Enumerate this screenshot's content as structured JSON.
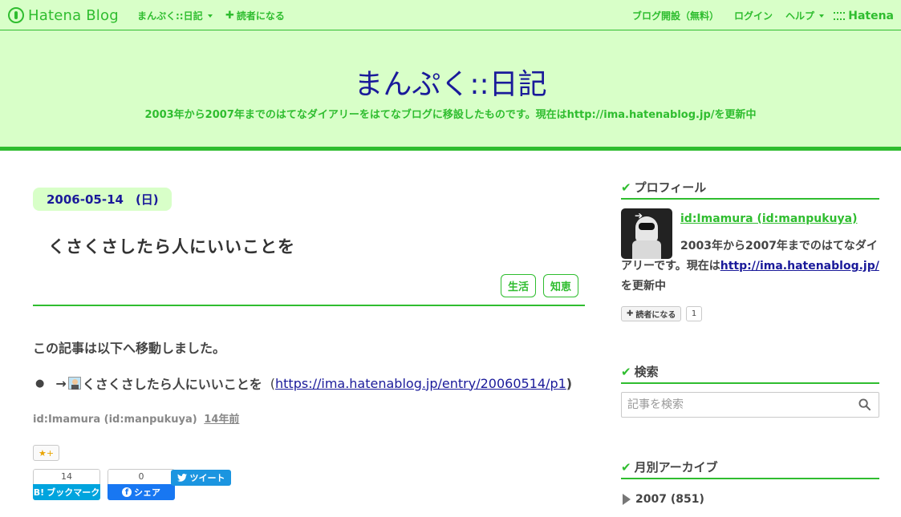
{
  "topbar": {
    "logo_text": "Hatena Blog",
    "blog_menu": "まんぷく::日記",
    "subscribe": "読者になる",
    "open_blog": "ブログ開設（無料）",
    "login": "ログイン",
    "help": "ヘルプ",
    "hatena": "Hatena"
  },
  "header": {
    "title": "まんぷく::日記",
    "description": "2003年から2007年までのはてなダイアリーをはてなブログに移設したものです。現在はhttp://ima.hatenablog.jp/を更新中"
  },
  "entry": {
    "date": "2006-05-14　(日)",
    "title": "くさくさしたら人にいいことを",
    "tags": [
      "生活",
      "知恵"
    ],
    "body": "この記事は以下へ移動しました。",
    "list_bullet": "●",
    "list_arrow": "→",
    "list_text": "くさくさしたら人にいいことを",
    "list_open_paren": "(",
    "list_link": "https://ima.hatenablog.jp/entry/20060514/p1",
    "list_close_paren": ")",
    "author": "id:Imamura (id:manpukuya)",
    "ago": "14年前",
    "star_plus": "+",
    "hatebu_count": "14",
    "hatebu_label": "ブックマーク",
    "fb_count": "0",
    "fb_label": "シェア",
    "tweet_label": "ツイート"
  },
  "sidebar": {
    "profile_title": "プロフィール",
    "profile_name": "id:Imamura (id:manpukuya)",
    "profile_desc_1": "2003年から2007年までのはてなダイアリーです。現在は",
    "profile_link": "http://ima.hatenablog.jp/",
    "profile_desc_2": "を更新中",
    "reader_label": "読者になる",
    "reader_count": "1",
    "search_title": "検索",
    "search_placeholder": "記事を検索",
    "archive_title": "月別アーカイブ",
    "archive_item": "2007 (851)"
  },
  "colors": {
    "accent": "#2fbd2f",
    "header_bg": "#d8ffc8",
    "title": "#1a1a9a",
    "link": "#1a1a9a"
  }
}
